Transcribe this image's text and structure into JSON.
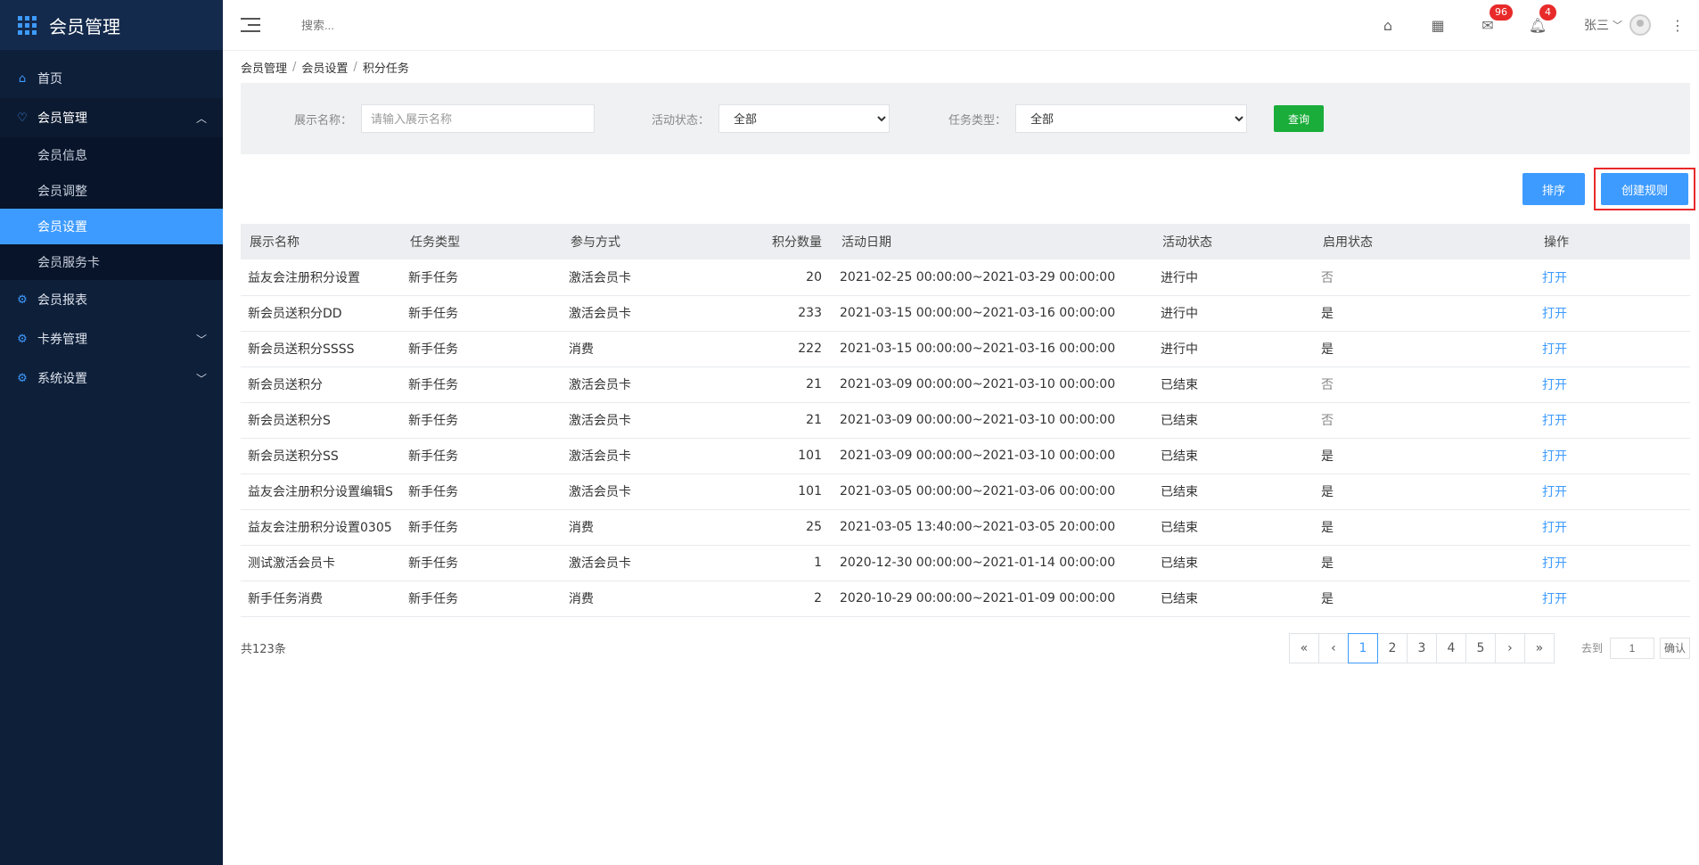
{
  "sidebar": {
    "brand_title": "会员管理",
    "items": [
      {
        "label": "首页"
      },
      {
        "label": "会员管理"
      },
      {
        "label": "会员报表"
      },
      {
        "label": "卡券管理"
      },
      {
        "label": "系统设置"
      }
    ],
    "sub_items": [
      {
        "label": "会员信息"
      },
      {
        "label": "会员调整"
      },
      {
        "label": "会员设置"
      },
      {
        "label": "会员服务卡"
      }
    ]
  },
  "topbar": {
    "search_placeholder": "搜索...",
    "mail_badge": "96",
    "bell_badge": "4",
    "user_name": "张三"
  },
  "breadcrumb": [
    "会员管理",
    "会员设置",
    "积分任务"
  ],
  "filter": {
    "name_label": "展示名称：",
    "name_placeholder": "请输入展示名称",
    "status_label": "活动状态：",
    "status_value": "全部",
    "type_label": "任务类型：",
    "type_value": "全部",
    "query_label": "查询"
  },
  "actions": {
    "sort_label": "排序",
    "create_label": "创建规则"
  },
  "table": {
    "headers": [
      "展示名称",
      "任务类型",
      "参与方式",
      "积分数量",
      "活动日期",
      "活动状态",
      "启用状态",
      "操作"
    ],
    "rows": [
      [
        "益友会注册积分设置",
        "新手任务",
        "激活会员卡",
        "20",
        "2021-02-25 00:00:00~2021-03-29 00:00:00",
        "进行中",
        "否",
        "打开"
      ],
      [
        "新会员送积分DD",
        "新手任务",
        "激活会员卡",
        "233",
        "2021-03-15 00:00:00~2021-03-16 00:00:00",
        "进行中",
        "是",
        "打开"
      ],
      [
        "新会员送积分SSSS",
        "新手任务",
        "消费",
        "222",
        "2021-03-15 00:00:00~2021-03-16 00:00:00",
        "进行中",
        "是",
        "打开"
      ],
      [
        "新会员送积分",
        "新手任务",
        "激活会员卡",
        "21",
        "2021-03-09 00:00:00~2021-03-10 00:00:00",
        "已结束",
        "否",
        "打开"
      ],
      [
        "新会员送积分S",
        "新手任务",
        "激活会员卡",
        "21",
        "2021-03-09 00:00:00~2021-03-10 00:00:00",
        "已结束",
        "否",
        "打开"
      ],
      [
        "新会员送积分SS",
        "新手任务",
        "激活会员卡",
        "101",
        "2021-03-09 00:00:00~2021-03-10 00:00:00",
        "已结束",
        "是",
        "打开"
      ],
      [
        "益友会注册积分设置编辑S",
        "新手任务",
        "激活会员卡",
        "101",
        "2021-03-05 00:00:00~2021-03-06 00:00:00",
        "已结束",
        "是",
        "打开"
      ],
      [
        "益友会注册积分设置0305",
        "新手任务",
        "消费",
        "25",
        "2021-03-05 13:40:00~2021-03-05 20:00:00",
        "已结束",
        "是",
        "打开"
      ],
      [
        "测试激活会员卡",
        "新手任务",
        "激活会员卡",
        "1",
        "2020-12-30 00:00:00~2021-01-14 00:00:00",
        "已结束",
        "是",
        "打开"
      ],
      [
        "新手任务消费",
        "新手任务",
        "消费",
        "2",
        "2020-10-29 00:00:00~2021-01-09 00:00:00",
        "已结束",
        "是",
        "打开"
      ]
    ]
  },
  "footer": {
    "total_text": "共123条",
    "pages": [
      "«",
      "‹",
      "1",
      "2",
      "3",
      "4",
      "5",
      "›",
      "»"
    ],
    "goto_label": "去到",
    "goto_value": "1",
    "confirm_label": "确认"
  }
}
